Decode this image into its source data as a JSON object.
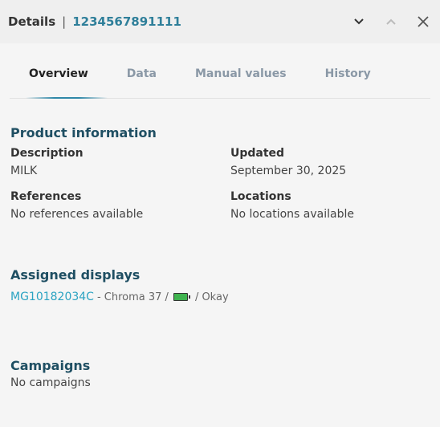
{
  "header": {
    "title": "Details",
    "separator": "|",
    "id": "1234567891111"
  },
  "tabs": [
    {
      "label": "Overview",
      "active": true
    },
    {
      "label": "Data",
      "active": false
    },
    {
      "label": "Manual values",
      "active": false
    },
    {
      "label": "History",
      "active": false
    }
  ],
  "product": {
    "section_title": "Product information",
    "description_label": "Description",
    "description_value": "MILK",
    "updated_label": "Updated",
    "updated_value": "September 30, 2025",
    "references_label": "References",
    "references_value": "No references available",
    "locations_label": "Locations",
    "locations_value": "No locations available"
  },
  "displays": {
    "section_title": "Assigned displays",
    "items": [
      {
        "id": "MG10182034C",
        "model": "- Chroma 37 /",
        "status": "/ Okay",
        "battery_color": "#3fb34f"
      }
    ]
  },
  "campaigns": {
    "section_title": "Campaigns",
    "empty_text": "No campaigns"
  },
  "colors": {
    "accent": "#2f7f9a",
    "link": "#2ba3c2",
    "section": "#1f4f63"
  },
  "icons": [
    "chevron-down-icon",
    "chevron-up-icon",
    "close-icon",
    "battery-icon"
  ]
}
